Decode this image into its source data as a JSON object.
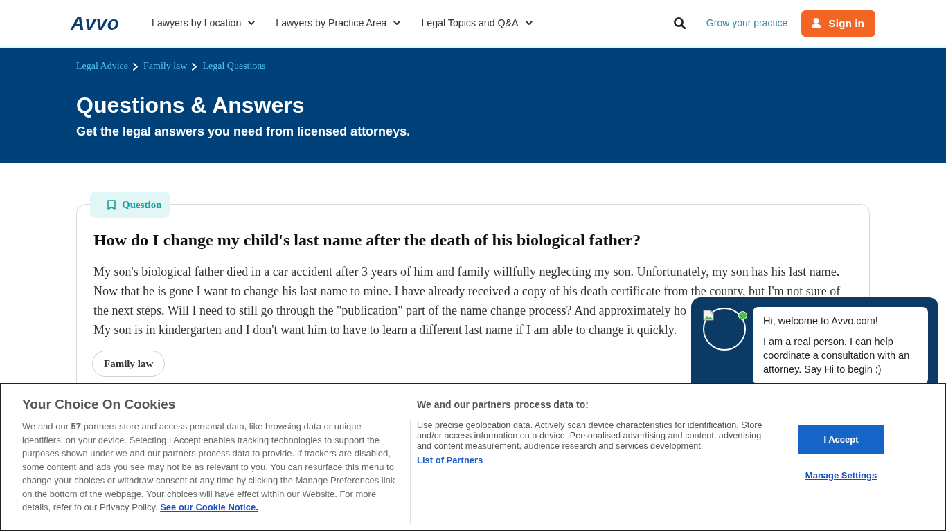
{
  "header": {
    "logo": "Avvo",
    "nav": [
      {
        "label": "Lawyers by Location"
      },
      {
        "label": "Lawyers by Practice Area"
      },
      {
        "label": "Legal Topics and Q&A"
      }
    ],
    "grow_link": "Grow your practice",
    "sign_in": "Sign in"
  },
  "hero": {
    "breadcrumbs": [
      "Legal Advice",
      "Family law",
      "Legal Questions"
    ],
    "title": "Questions & Answers",
    "subtitle": "Get the legal answers you need from licensed attorneys."
  },
  "question": {
    "badge": "Question",
    "title": "How do I change my child's last name after the death of his biological father?",
    "body": [
      "My son's biological father died in a car accident after 3 years of him and family willfully neglecting my son. Unfortunately, my son has his last name. Now that he is gone I want to change his last name to mine. I have already received a copy of his death certificate from the county, but I'm not sure of",
      "the next steps. Will I need to still go through the \"publication\" part of the name change process? And approximately ho",
      "My son is in kindergarten and I don't want him to have to learn a different last name if I am able to change it quickly."
    ],
    "tags": [
      "Family law"
    ]
  },
  "chat": {
    "operator": {
      "online": true
    },
    "greeting": "Hi, welcome to Avvo.com!",
    "message": "I am a real person. I can help coordinate a consultation with an attorney. Say Hi to begin :)"
  },
  "cookie_banner": {
    "title": "Your Choice On Cookies",
    "text": "We and our **57** partners store and access personal data, like browsing data or unique identifiers, on your device. Selecting I Accept enables tracking technologies to support the purposes shown under we and our partners process data to provide. If trackers are disabled, some content and ads you see may not be as relevant to you. You can resurface this menu to change your choices or withdraw consent at any time by clicking the Manage Preferences link on the bottom of the webpage. Your choices will have effect within our Website. For more details, refer to our Privacy Policy.",
    "notice_link": "See our Cookie Notice.",
    "purposes_heading": "We and our partners process data to:",
    "purposes": "Use precise geolocation data. Actively scan device characteristics for identification. Store and/or access information on a device. Personalised advertising and content, advertising and content measurement, audience research and services development.",
    "partners_link": "List of Partners",
    "accept": "I Accept",
    "manage": "Manage Settings"
  }
}
